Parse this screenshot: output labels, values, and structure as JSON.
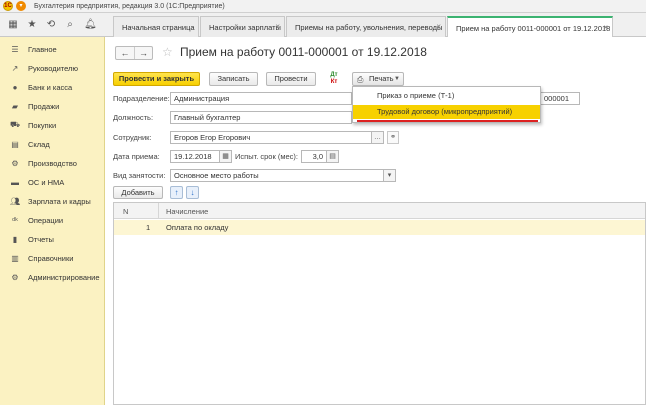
{
  "window": {
    "title": "Бухгалтерия предприятия, редакция 3.0 (1С:Предприятие)",
    "logo_text": "1С"
  },
  "tabs": [
    {
      "label": "Начальная страница"
    },
    {
      "label": "Настройки зарплаты"
    },
    {
      "label": "Приемы на работу, увольнения, переводы"
    },
    {
      "label": "Прием на работу 0011-000001 от 19.12.2018"
    }
  ],
  "sidebar": {
    "items": [
      {
        "label": "Главное",
        "icon": "menu-icon"
      },
      {
        "label": "Руководителю",
        "icon": "trend-icon"
      },
      {
        "label": "Банк и касса",
        "icon": "bank-icon"
      },
      {
        "label": "Продажи",
        "icon": "sales-icon"
      },
      {
        "label": "Покупки",
        "icon": "cart-icon"
      },
      {
        "label": "Склад",
        "icon": "warehouse-icon"
      },
      {
        "label": "Производство",
        "icon": "production-icon"
      },
      {
        "label": "ОС и НМА",
        "icon": "truck-icon"
      },
      {
        "label": "Зарплата и кадры",
        "icon": "people-icon"
      },
      {
        "label": "Операции",
        "icon": "operations-icon"
      },
      {
        "label": "Отчеты",
        "icon": "reports-icon"
      },
      {
        "label": "Справочники",
        "icon": "books-icon"
      },
      {
        "label": "Администрирование",
        "icon": "gear-icon"
      }
    ]
  },
  "document": {
    "title": "Прием на работу 0011-000001 от 19.12.2018"
  },
  "toolbar": {
    "post_close_label": "Провести и закрыть",
    "save_label": "Записать",
    "post_label": "Провести",
    "print_label": "Печать"
  },
  "print_menu": {
    "items": [
      {
        "label": "Приказ о приеме (Т-1)"
      },
      {
        "label": "Трудовой договор (микропредприятий)"
      }
    ],
    "highlighted_index": 1
  },
  "form": {
    "department_label": "Подразделение:",
    "department_value": "Администрация",
    "number_value": "000001",
    "position_label": "Должность:",
    "position_value": "Главный бухгалтер",
    "employee_label": "Сотрудник:",
    "employee_value": "Егоров Егор Егорович",
    "hire_date_label": "Дата приема:",
    "hire_date_value": "19.12.2018",
    "probation_label": "Испыт. срок (мес):",
    "probation_value": "3,0",
    "employment_type_label": "Вид занятости:",
    "employment_type_value": "Основное место работы"
  },
  "accruals": {
    "add_label": "Добавить",
    "columns": [
      "N",
      "Начисление"
    ],
    "rows": [
      {
        "n": "1",
        "name": "Оплата по окладу"
      }
    ]
  },
  "colors": {
    "primary_button": "#f7cf00",
    "sidebar_bg": "#fbf2c2",
    "highlight": "#f7d100",
    "active_tab_accent": "#3cb371",
    "error_underline": "#dd2222"
  }
}
